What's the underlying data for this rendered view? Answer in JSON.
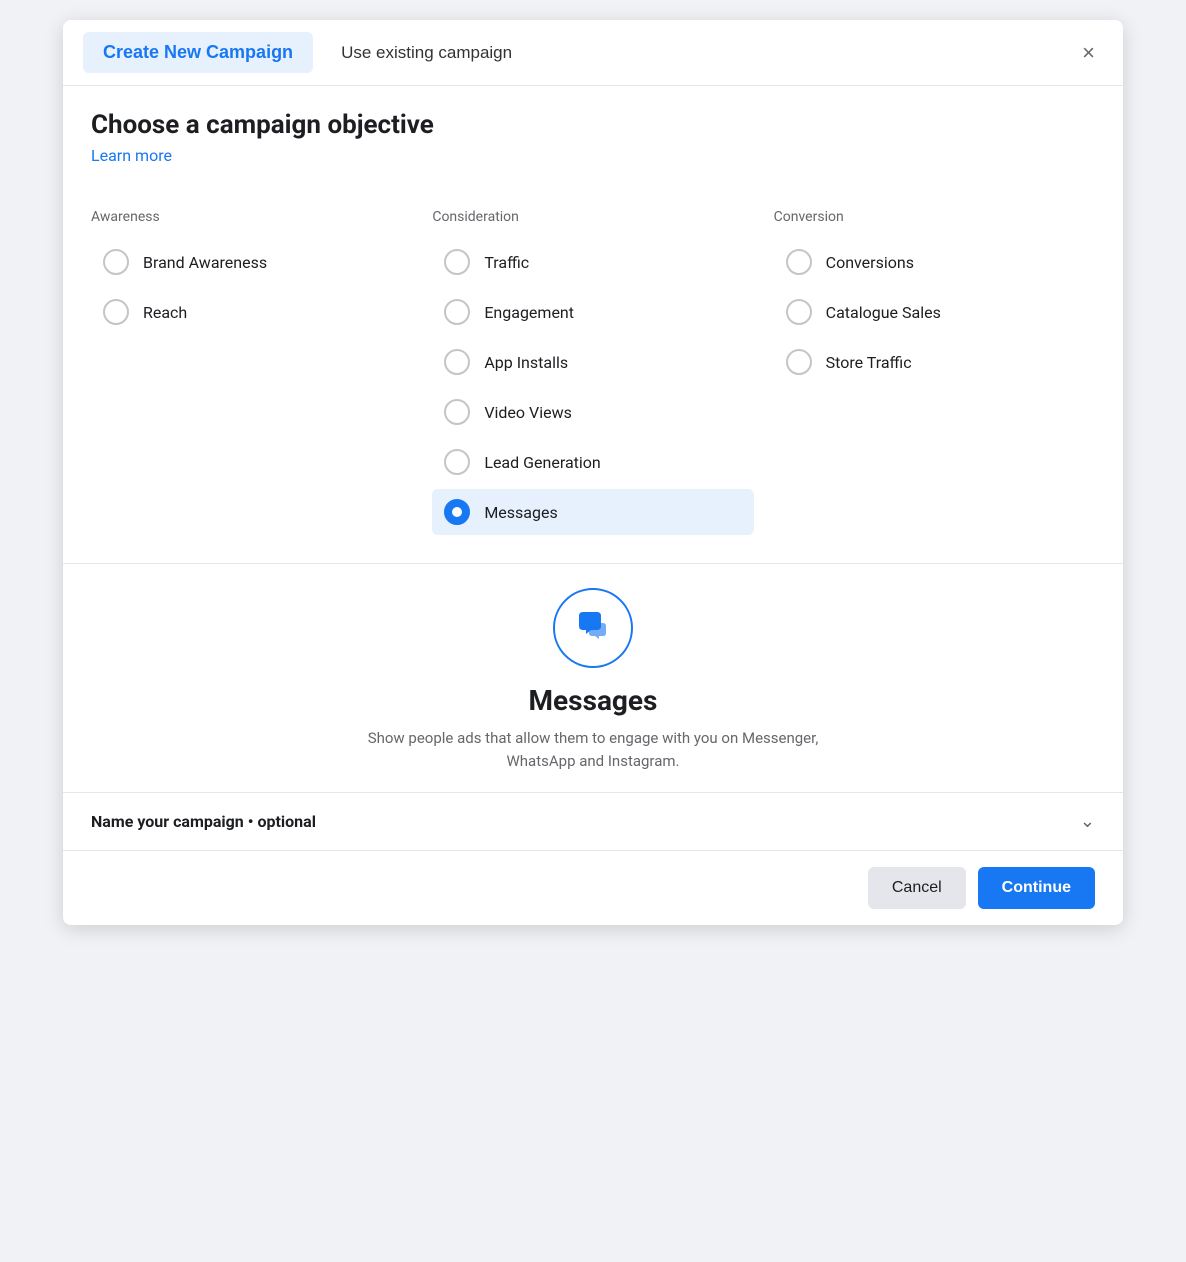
{
  "header": {
    "tab_create": "Create New Campaign",
    "tab_existing": "Use existing campaign",
    "close_label": "×"
  },
  "body": {
    "title": "Choose a campaign objective",
    "learn_more": "Learn more"
  },
  "columns": [
    {
      "title": "Awareness",
      "options": [
        {
          "id": "brand-awareness",
          "label": "Brand Awareness",
          "selected": false
        },
        {
          "id": "reach",
          "label": "Reach",
          "selected": false
        }
      ]
    },
    {
      "title": "Consideration",
      "options": [
        {
          "id": "traffic",
          "label": "Traffic",
          "selected": false
        },
        {
          "id": "engagement",
          "label": "Engagement",
          "selected": false
        },
        {
          "id": "app-installs",
          "label": "App Installs",
          "selected": false
        },
        {
          "id": "video-views",
          "label": "Video Views",
          "selected": false
        },
        {
          "id": "lead-generation",
          "label": "Lead Generation",
          "selected": false
        },
        {
          "id": "messages",
          "label": "Messages",
          "selected": true
        }
      ]
    },
    {
      "title": "Conversion",
      "options": [
        {
          "id": "conversions",
          "label": "Conversions",
          "selected": false
        },
        {
          "id": "catalogue-sales",
          "label": "Catalogue Sales",
          "selected": false
        },
        {
          "id": "store-traffic",
          "label": "Store Traffic",
          "selected": false
        }
      ]
    }
  ],
  "preview": {
    "title": "Messages",
    "description": "Show people ads that allow them to engage with you on Messenger, WhatsApp and Instagram."
  },
  "campaign_name": {
    "label": "Name your campaign • optional"
  },
  "footer": {
    "cancel": "Cancel",
    "continue": "Continue"
  },
  "colors": {
    "accent": "#1877f2",
    "selected_bg": "#e7f0fd"
  }
}
